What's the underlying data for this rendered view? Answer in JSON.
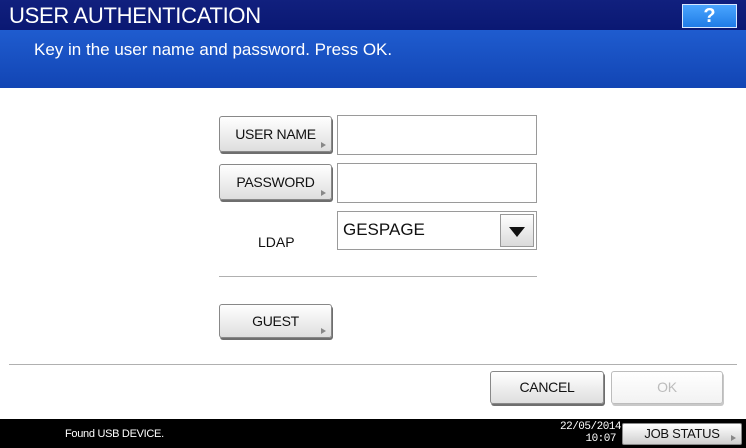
{
  "header": {
    "title": "USER AUTHENTICATION",
    "help_label": "?",
    "instruction": "Key in the user name and password. Press OK."
  },
  "form": {
    "user_name_button": "USER NAME",
    "user_name_value": "",
    "password_button": "PASSWORD",
    "password_value": "",
    "ldap_label": "LDAP",
    "ldap_selected": "GESPAGE",
    "guest_button": "GUEST"
  },
  "actions": {
    "cancel_label": "CANCEL",
    "ok_label": "OK"
  },
  "status": {
    "message": "Found USB DEVICE.",
    "date": "22/05/2014",
    "time": "10:07",
    "job_status_label": "JOB STATUS"
  },
  "icons": {
    "help": "question-mark-icon",
    "dropdown": "chevron-down-icon",
    "button_corner": "corner-arrow-icon"
  },
  "colors": {
    "title_bar": "#0a1873",
    "instruction_bar": "#1245b4",
    "help_button": "#1f7be6",
    "status_bar": "#000000",
    "disabled_text": "#bcbcbc"
  }
}
